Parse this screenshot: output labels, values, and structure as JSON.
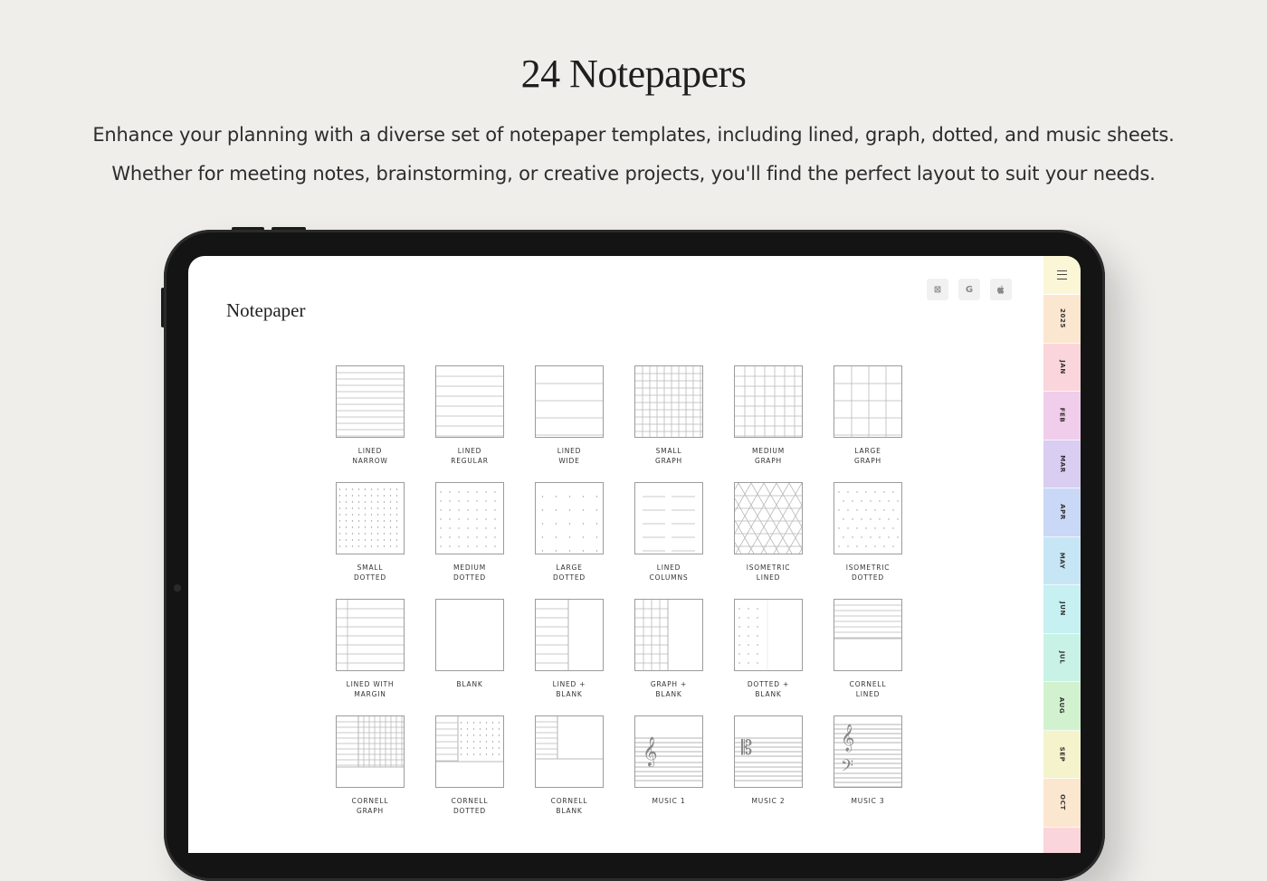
{
  "headline": "24 Notepapers",
  "subtitle_line1": "Enhance your planning with a diverse set of notepaper templates, including lined, graph, dotted, and music sheets.",
  "subtitle_line2": "Whether for meeting notes, brainstorming, or creative projects, you'll find the perfect layout to suit your needs.",
  "screen": {
    "title": "Notepaper",
    "top_icons": [
      {
        "icon": "outlook-icon",
        "glyph": "⊠"
      },
      {
        "icon": "google-icon",
        "glyph": "G"
      },
      {
        "icon": "apple-icon",
        "glyph": ""
      }
    ]
  },
  "templates": [
    {
      "id": "lined-narrow",
      "line1": "LINED",
      "line2": "NARROW",
      "pattern": "lines",
      "spacing": 7
    },
    {
      "id": "lined-regular",
      "line1": "LINED",
      "line2": "REGULAR",
      "pattern": "lines",
      "spacing": 11
    },
    {
      "id": "lined-wide",
      "line1": "LINED",
      "line2": "WIDE",
      "pattern": "lines",
      "spacing": 19
    },
    {
      "id": "small-graph",
      "line1": "SMALL",
      "line2": "GRAPH",
      "pattern": "graph",
      "spacing": 8
    },
    {
      "id": "medium-graph",
      "line1": "MEDIUM",
      "line2": "GRAPH",
      "pattern": "graph",
      "spacing": 11
    },
    {
      "id": "large-graph",
      "line1": "LARGE",
      "line2": "GRAPH",
      "pattern": "graph",
      "spacing": 19
    },
    {
      "id": "small-dotted",
      "line1": "SMALL",
      "line2": "DOTTED",
      "pattern": "dots",
      "spacing": 7
    },
    {
      "id": "medium-dotted",
      "line1": "MEDIUM",
      "line2": "DOTTED",
      "pattern": "dots",
      "spacing": 10
    },
    {
      "id": "large-dotted",
      "line1": "LARGE",
      "line2": "DOTTED",
      "pattern": "dots",
      "spacing": 15
    },
    {
      "id": "lined-columns",
      "line1": "LINED",
      "line2": "COLUMNS",
      "pattern": "columns",
      "spacing": 15
    },
    {
      "id": "isometric-lined",
      "line1": "ISOMETRIC",
      "line2": "LINED",
      "pattern": "iso",
      "spacing": 14
    },
    {
      "id": "isometric-dotted",
      "line1": "ISOMETRIC",
      "line2": "DOTTED",
      "pattern": "isodots",
      "spacing": 10
    },
    {
      "id": "lined-with-margin",
      "line1": "LINED WITH",
      "line2": "MARGIN",
      "pattern": "margin",
      "spacing": 10
    },
    {
      "id": "blank",
      "line1": "BLANK",
      "line2": "",
      "pattern": "blank",
      "spacing": 0
    },
    {
      "id": "lined-blank",
      "line1": "LINED +",
      "line2": "BLANK",
      "pattern": "linedhalf",
      "spacing": 10
    },
    {
      "id": "graph-blank",
      "line1": "GRAPH +",
      "line2": "BLANK",
      "pattern": "graphhalf",
      "spacing": 10
    },
    {
      "id": "dotted-blank",
      "line1": "DOTTED +",
      "line2": "BLANK",
      "pattern": "dotshalf",
      "spacing": 10
    },
    {
      "id": "cornell-lined",
      "line1": "CORNELL",
      "line2": "LINED",
      "pattern": "cornell-lined",
      "spacing": 6
    },
    {
      "id": "cornell-graph",
      "line1": "CORNELL",
      "line2": "GRAPH",
      "pattern": "cornell-graph",
      "spacing": 6
    },
    {
      "id": "cornell-dotted",
      "line1": "CORNELL",
      "line2": "DOTTED",
      "pattern": "cornell-dotted",
      "spacing": 7
    },
    {
      "id": "cornell-blank",
      "line1": "CORNELL",
      "line2": "BLANK",
      "pattern": "cornell-blank",
      "spacing": 6
    },
    {
      "id": "music-1",
      "line1": "MUSIC 1",
      "line2": "",
      "pattern": "music1",
      "spacing": 5
    },
    {
      "id": "music-2",
      "line1": "MUSIC 2",
      "line2": "",
      "pattern": "music2",
      "spacing": 5
    },
    {
      "id": "music-3",
      "line1": "MUSIC 3",
      "line2": "",
      "pattern": "music3",
      "spacing": 5
    }
  ],
  "tabs": [
    {
      "label": "2025",
      "color": "#fbe6cf"
    },
    {
      "label": "JAN",
      "color": "#fad5dc"
    },
    {
      "label": "FEB",
      "color": "#f0cdea"
    },
    {
      "label": "MAR",
      "color": "#d9cdf2"
    },
    {
      "label": "APR",
      "color": "#c9d8f6"
    },
    {
      "label": "MAY",
      "color": "#c6e6f5"
    },
    {
      "label": "JUN",
      "color": "#c6f0f2"
    },
    {
      "label": "JUL",
      "color": "#c9f2e6"
    },
    {
      "label": "AUG",
      "color": "#d2f2cf"
    },
    {
      "label": "SEP",
      "color": "#f4f3cc"
    },
    {
      "label": "OCT",
      "color": "#fbe6cf"
    },
    {
      "label": "",
      "color": "#fad5dc"
    }
  ]
}
